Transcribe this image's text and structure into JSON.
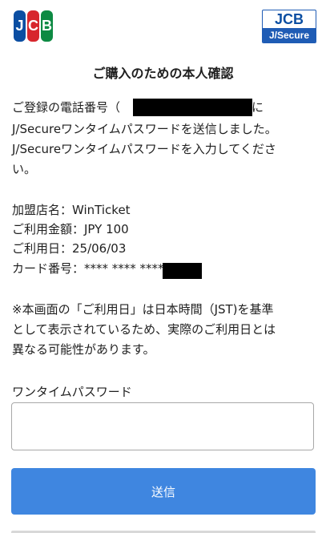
{
  "header": {
    "jcb_logo_letters": [
      "J",
      "C",
      "B"
    ],
    "jsecure_logo_top": "JCB",
    "jsecure_logo_bottom": "J/Secure",
    "title": "ご購入のための本人確認"
  },
  "message": {
    "line1_prefix": "ご登録の電話番号（",
    "line1_suffix": "）に",
    "line2": "J/Secureワンタイムパスワードを送信しました。",
    "line3": "J/Secureワンタイムパスワードを入力してくださ",
    "line4": "い。"
  },
  "details": {
    "merchant": "加盟店名：WinTicket",
    "amount": "ご利用金額：JPY 100",
    "date": "ご利用日：25/06/03",
    "card_prefix": "カード番号：**** **** ****"
  },
  "notice": {
    "line1": "※本画面の「ご利用日」は日本時間（JST)を基準",
    "line2": "として表示されているため、実際のご利用日とは",
    "line3": "異なる可能性があります。"
  },
  "otp": {
    "label": "ワンタイムパスワード",
    "value": "",
    "placeholder": ""
  },
  "submit": {
    "label": "送信",
    "color": "#3f86e0"
  }
}
